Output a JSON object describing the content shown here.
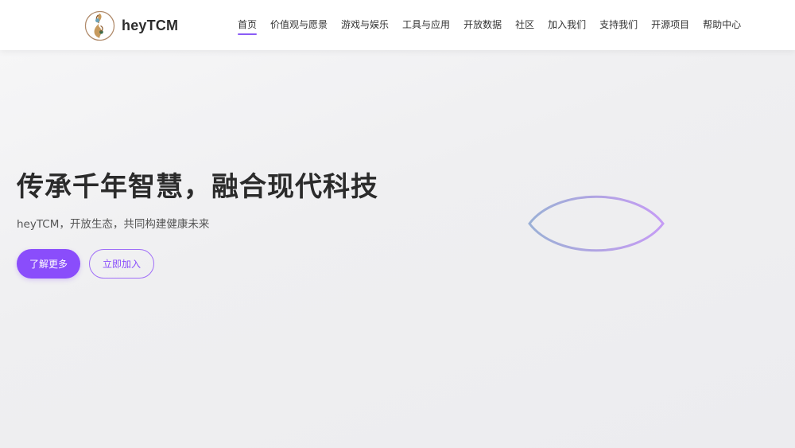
{
  "brand": {
    "name": "heyTCM",
    "logo_icon": "yin-yang-seahorse-logo",
    "accent_color": "#8a4dfb"
  },
  "nav": {
    "items": [
      {
        "label": "首页",
        "active": true
      },
      {
        "label": "价值观与愿景",
        "active": false
      },
      {
        "label": "游戏与娱乐",
        "active": false
      },
      {
        "label": "工具与应用",
        "active": false
      },
      {
        "label": "开放数据",
        "active": false
      },
      {
        "label": "社区",
        "active": false
      },
      {
        "label": "加入我们",
        "active": false
      },
      {
        "label": "支持我们",
        "active": false
      },
      {
        "label": "开源项目",
        "active": false
      },
      {
        "label": "帮助中心",
        "active": false
      }
    ]
  },
  "hero": {
    "title": "传承千年智慧，融合现代科技",
    "subtitle": "heyTCM，开放生态，共同构建健康未来",
    "primary_button": "了解更多",
    "secondary_button": "立即加入",
    "graphic_icon": "eye-outline-graphic"
  }
}
